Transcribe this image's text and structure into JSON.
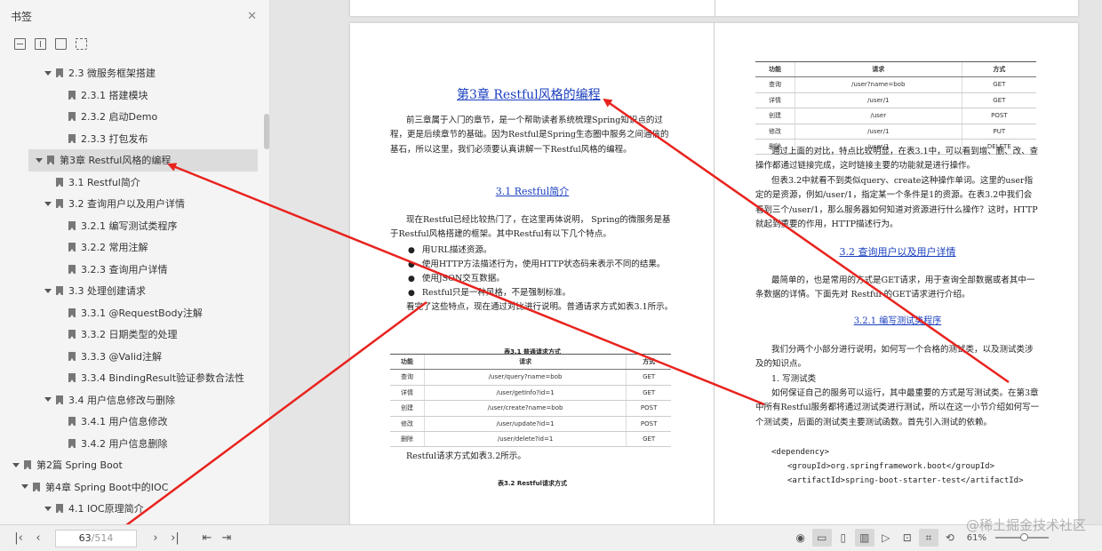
{
  "sidebar": {
    "title": "书签",
    "items": [
      {
        "label": "2.3 微服务框架搭建",
        "level": 2,
        "expand": true
      },
      {
        "label": "2.3.1 搭建模块",
        "level": 3,
        "expand": false
      },
      {
        "label": "2.3.2 启动Demo",
        "level": 3,
        "expand": false
      },
      {
        "label": "2.3.3 打包发布",
        "level": 3,
        "expand": false
      },
      {
        "label": "第3章 Restful风格的编程",
        "level": 1,
        "expand": true,
        "selected": true
      },
      {
        "label": "3.1 Restful简介",
        "level": 2,
        "expand": false
      },
      {
        "label": "3.2 查询用户以及用户详情",
        "level": 2,
        "expand": true
      },
      {
        "label": "3.2.1 编写测试类程序",
        "level": 3,
        "expand": false
      },
      {
        "label": "3.2.2 常用注解",
        "level": 3,
        "expand": false
      },
      {
        "label": "3.2.3 查询用户详情",
        "level": 3,
        "expand": false
      },
      {
        "label": "3.3 处理创建请求",
        "level": 2,
        "expand": true
      },
      {
        "label": "3.3.1 @RequestBody注解",
        "level": 3,
        "expand": false
      },
      {
        "label": "3.3.2 日期类型的处理",
        "level": 3,
        "expand": false
      },
      {
        "label": "3.3.3 @Valid注解",
        "level": 3,
        "expand": false
      },
      {
        "label": "3.3.4 BindingResult验证参数合法性",
        "level": 3,
        "expand": false
      },
      {
        "label": "3.4 用户信息修改与删除",
        "level": 2,
        "expand": true
      },
      {
        "label": "3.4.1 用户信息修改",
        "level": 3,
        "expand": false
      },
      {
        "label": "3.4.2 用户信息删除",
        "level": 3,
        "expand": false
      },
      {
        "label": "第2篇 Spring Boot",
        "level": 0,
        "expand": true
      },
      {
        "label": "第4章 Spring Boot中的IOC",
        "level": 1,
        "expand": true
      },
      {
        "label": "4.1 IOC原理简介",
        "level": 2,
        "expand": true
      }
    ]
  },
  "doc": {
    "left": {
      "chapter_title": "第3章 Restful风格的编程",
      "p1": "前三章属于入门的章节，是一个帮助读者系统梳理Spring知识点的过程，更是后续章节的基础。因为Restful是Spring生态圈中服务之间通信的基石，所以这里，我们必须要认真讲解一下Restful风格的编程。",
      "sec31": "3.1 Restful简介",
      "p2": "现在Restful已经比较热门了，在这里再体说明， Spring的微服务是基于Restful风格搭建的框架。其中Restful有以下几个特点。",
      "b1": "用URL描述资源。",
      "b2": "使用HTTP方法描述行为，使用HTTP状态码来表示不同的结果。",
      "b3": "使用JSON交互数据。",
      "b4": "Restful只是一种风格，不是强制标准。",
      "p3": "看完了这些特点，现在通过对比进行说明。普通请求方式如表3.1所示。",
      "t1_caption": "表3.1 普通请求方式",
      "t1_headers": [
        "功能",
        "请求",
        "方式"
      ],
      "t1_rows": [
        [
          "查询",
          "/user/query?name=bob",
          "GET"
        ],
        [
          "详情",
          "/user/getInfo?id=1",
          "GET"
        ],
        [
          "创建",
          "/user/create?name=bob",
          "POST"
        ],
        [
          "修改",
          "/user/update?id=1",
          "POST"
        ],
        [
          "删除",
          "/user/delete?id=1",
          "GET"
        ]
      ],
      "p4": "Restful请求方式如表3.2所示。",
      "t2_caption": "表3.2 Restful请求方式"
    },
    "right": {
      "t_headers": [
        "功能",
        "请求",
        "方式"
      ],
      "t_rows": [
        [
          "查询",
          "/user?name=bob",
          "GET"
        ],
        [
          "详情",
          "/user/1",
          "GET"
        ],
        [
          "创建",
          "/user",
          "POST"
        ],
        [
          "修改",
          "/user/1",
          "PUT"
        ],
        [
          "删除",
          "/user/1",
          "DELETE"
        ]
      ],
      "p1": "通过上面的对比，特点比较明显，在表3.1中，可以看到增、删、改、查操作都通过链接完成，这时链接主要的功能就是进行操作。",
      "p2": "但表3.2中就看不到类似query、create这种操作单词。这里的user指定的是资源，例如/user/1，指定某一个条件是1的资源。在表3.2中我们会看到三个/user/1，那么服务器如何知道对资源进行什么操作？这时，HTTP就起到重要的作用，HTTP描述行为。",
      "sec32": "3.2 查询用户以及用户详情",
      "p3": "最简单的，也是常用的方式是GET请求，用于查询全部数据或者其中一条数据的详情。下面先对 Restful 的GET请求进行介绍。",
      "sec321": "3.2.1 编写测试类程序",
      "p4": "我们分两个小部分进行说明，如何写一个合格的测试类，以及测试类涉及的知识点。",
      "p5": "1. 写测试类",
      "p6": "如何保证自己的服务可以运行，其中最重要的方式是写测试类。在第3章中所有Restful服务都将通过测试类进行测试，所以在这一小节介绍如何写一个测试类，后面的测试类主要测试函数。首先引入测试的依赖。",
      "code1": "<dependency>",
      "code2": "<groupId>org.springframework.boot</groupId>",
      "code3": "<artifactId>spring-boot-starter-test</artifactId>"
    }
  },
  "bottombar": {
    "page_current": "63",
    "page_total": "/514",
    "zoom": "61%"
  },
  "watermark": "@稀土掘金技术社区",
  "colors": {
    "link": "#1a3fbf",
    "arrow": "#e8231e"
  }
}
